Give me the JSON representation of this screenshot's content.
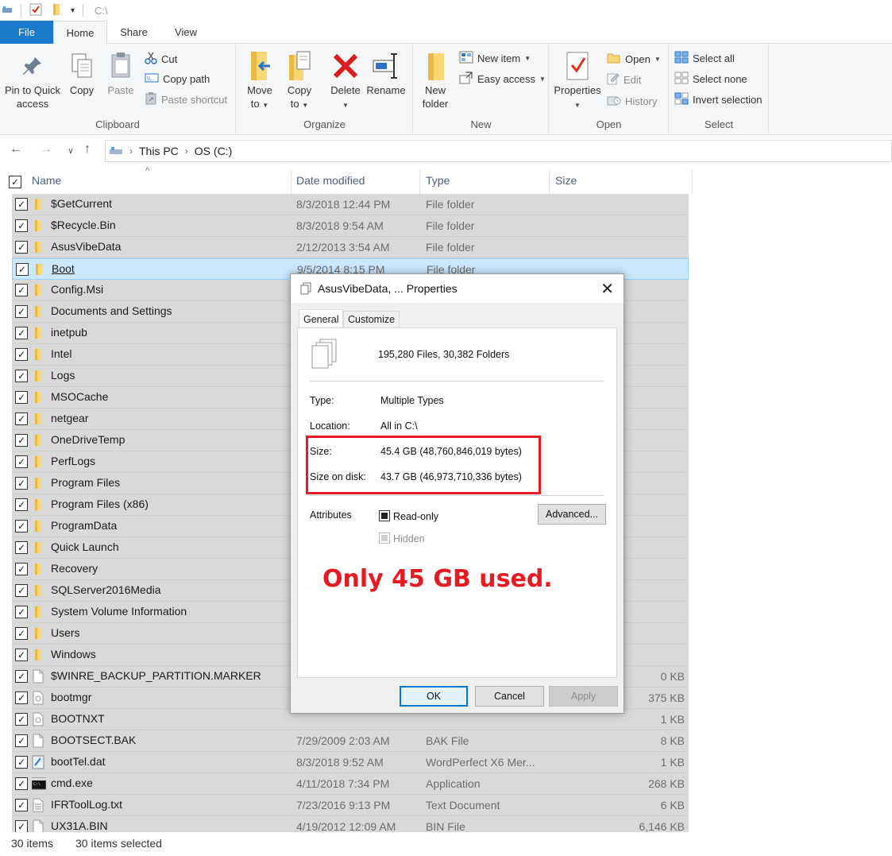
{
  "titlebar": {
    "path": "C:\\"
  },
  "tabs": [
    {
      "label": "File"
    },
    {
      "label": "Home"
    },
    {
      "label": "Share"
    },
    {
      "label": "View"
    }
  ],
  "ribbon": {
    "clipboard": {
      "label": "Clipboard",
      "pin": "Pin to Quick\naccess",
      "pin_line1": "Pin to Quick",
      "pin_line2": "access",
      "copy": "Copy",
      "paste": "Paste",
      "cut": "Cut",
      "copy_path": "Copy path",
      "paste_shortcut": "Paste shortcut"
    },
    "organize": {
      "label": "Organize",
      "move_to_1": "Move",
      "move_to_2": "to",
      "copy_to_1": "Copy",
      "copy_to_2": "to",
      "delete": "Delete",
      "rename": "Rename"
    },
    "new": {
      "label": "New",
      "new_folder_1": "New",
      "new_folder_2": "folder",
      "new_item": "New item",
      "easy_access": "Easy access"
    },
    "open": {
      "label": "Open",
      "properties": "Properties",
      "open": "Open",
      "edit": "Edit",
      "history": "History"
    },
    "select": {
      "label": "Select",
      "select_all": "Select all",
      "select_none": "Select none",
      "invert": "Invert selection"
    }
  },
  "address": {
    "crumbs": [
      "This PC",
      "OS (C:)"
    ]
  },
  "columns": {
    "name": "Name",
    "date": "Date modified",
    "type": "Type",
    "size": "Size"
  },
  "rows": [
    {
      "name": "$GetCurrent",
      "date": "8/3/2018 12:44 PM",
      "type": "File folder",
      "size": "",
      "icon": "folder"
    },
    {
      "name": "$Recycle.Bin",
      "date": "8/3/2018 9:54 AM",
      "type": "File folder",
      "size": "",
      "icon": "folder"
    },
    {
      "name": "AsusVibeData",
      "date": "2/12/2013 3:54 AM",
      "type": "File folder",
      "size": "",
      "icon": "folder"
    },
    {
      "name": "Boot",
      "date": "9/5/2014 8:15 PM",
      "type": "File folder",
      "size": "",
      "icon": "folder",
      "highlighted": true
    },
    {
      "name": "Config.Msi",
      "date": "",
      "type": "",
      "size": "",
      "icon": "folder"
    },
    {
      "name": "Documents and Settings",
      "date": "",
      "type": "",
      "size": "",
      "icon": "folder"
    },
    {
      "name": "inetpub",
      "date": "",
      "type": "",
      "size": "",
      "icon": "folder"
    },
    {
      "name": "Intel",
      "date": "",
      "type": "",
      "size": "",
      "icon": "folder"
    },
    {
      "name": "Logs",
      "date": "",
      "type": "",
      "size": "",
      "icon": "folder"
    },
    {
      "name": "MSOCache",
      "date": "",
      "type": "",
      "size": "",
      "icon": "folder"
    },
    {
      "name": "netgear",
      "date": "",
      "type": "",
      "size": "",
      "icon": "folder"
    },
    {
      "name": "OneDriveTemp",
      "date": "",
      "type": "",
      "size": "",
      "icon": "folder"
    },
    {
      "name": "PerfLogs",
      "date": "",
      "type": "",
      "size": "",
      "icon": "folder"
    },
    {
      "name": "Program Files",
      "date": "",
      "type": "",
      "size": "",
      "icon": "folder"
    },
    {
      "name": "Program Files (x86)",
      "date": "",
      "type": "",
      "size": "",
      "icon": "folder"
    },
    {
      "name": "ProgramData",
      "date": "",
      "type": "",
      "size": "",
      "icon": "folder"
    },
    {
      "name": "Quick Launch",
      "date": "",
      "type": "",
      "size": "",
      "icon": "folder"
    },
    {
      "name": "Recovery",
      "date": "",
      "type": "",
      "size": "",
      "icon": "folder"
    },
    {
      "name": "SQLServer2016Media",
      "date": "",
      "type": "",
      "size": "",
      "icon": "folder"
    },
    {
      "name": "System Volume Information",
      "date": "",
      "type": "",
      "size": "",
      "icon": "folder"
    },
    {
      "name": "Users",
      "date": "",
      "type": "",
      "size": "",
      "icon": "folder"
    },
    {
      "name": "Windows",
      "date": "",
      "type": "",
      "size": "",
      "icon": "folder"
    },
    {
      "name": "$WINRE_BACKUP_PARTITION.MARKER",
      "date": "",
      "type": "",
      "size": "0 KB",
      "icon": "file"
    },
    {
      "name": "bootmgr",
      "date": "",
      "type": "",
      "size": "375 KB",
      "icon": "sysfile"
    },
    {
      "name": "BOOTNXT",
      "date": "",
      "type": "",
      "size": "1 KB",
      "icon": "sysfile"
    },
    {
      "name": "BOOTSECT.BAK",
      "date": "7/29/2009 2:03 AM",
      "type": "BAK File",
      "size": "8 KB",
      "icon": "file"
    },
    {
      "name": "bootTel.dat",
      "date": "8/3/2018 9:52 AM",
      "type": "WordPerfect X6 Mer...",
      "size": "1 KB",
      "icon": "dat"
    },
    {
      "name": "cmd.exe",
      "date": "4/11/2018 7:34 PM",
      "type": "Application",
      "size": "268 KB",
      "icon": "exe"
    },
    {
      "name": "IFRToolLog.txt",
      "date": "7/23/2016 9:13 PM",
      "type": "Text Document",
      "size": "6 KB",
      "icon": "txt"
    },
    {
      "name": "UX31A.BIN",
      "date": "4/19/2012 12:09 AM",
      "type": "BIN File",
      "size": "6,146 KB",
      "icon": "file"
    }
  ],
  "status": {
    "items": "30 items",
    "selected": "30 items selected"
  },
  "dialog": {
    "title": "AsusVibeData, ... Properties",
    "tabs": [
      "General",
      "Customize"
    ],
    "summary": "195,280 Files, 30,382 Folders",
    "type_label": "Type:",
    "type_value": "Multiple Types",
    "location_label": "Location:",
    "location_value": "All in C:\\",
    "size_label": "Size:",
    "size_value": "45.4 GB (48,760,846,019 bytes)",
    "size_on_disk_label": "Size on disk:",
    "size_on_disk_value": "43.7 GB (46,973,710,336 bytes)",
    "attributes_label": "Attributes",
    "readonly_label": "Read-only",
    "hidden_label": "Hidden",
    "advanced_button": "Advanced...",
    "annotation": "Only 45 GB used.",
    "ok": "OK",
    "cancel": "Cancel",
    "apply": "Apply"
  },
  "colors": {
    "file_tab": "#1979ca",
    "selection_row": "#d9d9d9",
    "highlight_row": "#cce8ff",
    "annotation_red": "#e41b23",
    "folder_yellow": "#f8d775"
  }
}
